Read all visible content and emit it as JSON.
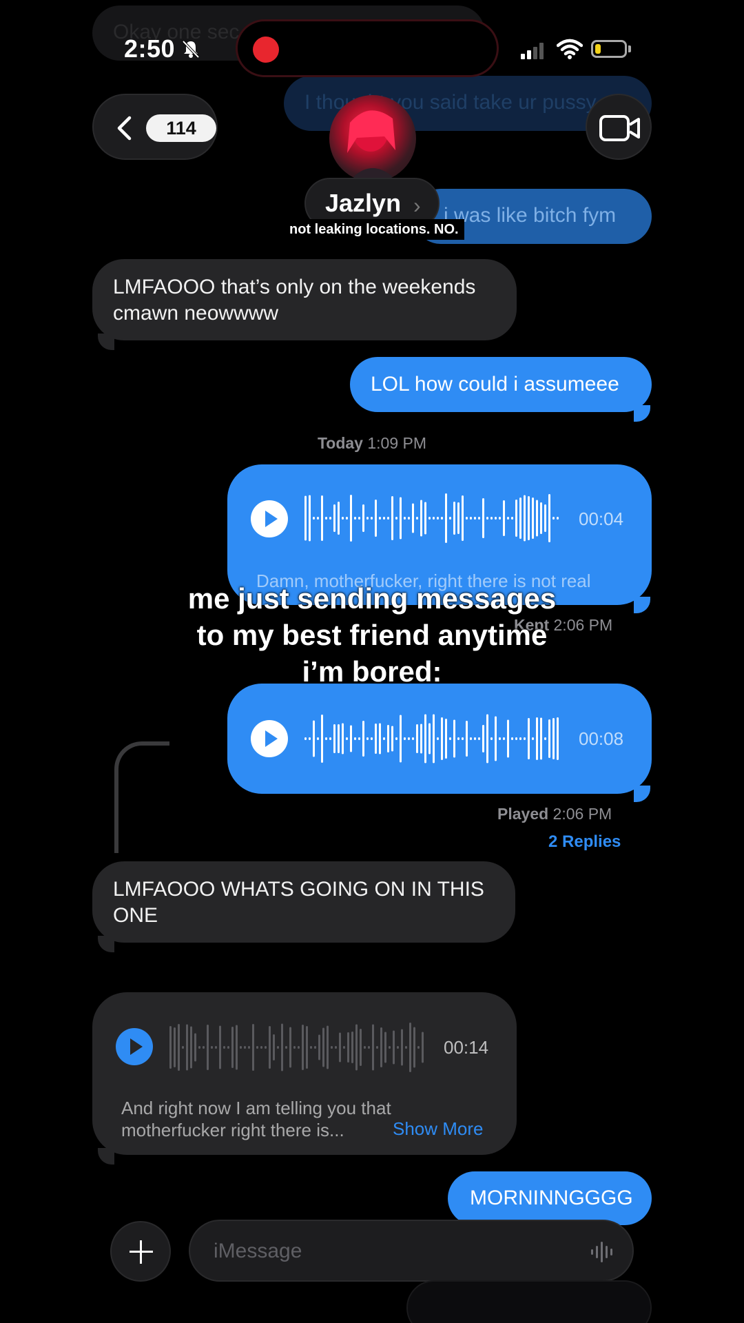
{
  "status_bar": {
    "time": "2:50"
  },
  "nav": {
    "unread_count": "114",
    "contact_name": "Jazlyn",
    "name_chevron": "›"
  },
  "caption_top": "not leaking locations. NO.",
  "background_messages": [
    {
      "text": "Okay one sec"
    },
    {
      "text": "I thought you said take ur pussy"
    },
    {
      "text": "i was like bitch fym"
    }
  ],
  "messages": [
    {
      "text": "LMFAOOO that’s only on the weekends cmawn neowwww"
    },
    {
      "text": "LOL how could i assumeee"
    },
    {
      "text": "LMFAOOO WHATS GOING ON IN THIS ONE"
    },
    {
      "text": "MORNINNGGGG"
    }
  ],
  "timestamps": {
    "today_label": "Today",
    "today_time": "1:09 PM",
    "kept_label": "Kept",
    "kept_time": "2:06 PM",
    "played_label": "Played",
    "played_time": "2:06 PM"
  },
  "replies_link": "2 Replies",
  "voice_messages": [
    {
      "duration": "00:04",
      "transcript": "Damn, motherfucker, right there is not real"
    },
    {
      "duration": "00:08"
    },
    {
      "duration": "00:14",
      "transcript_line1": "And right now I am telling you that",
      "transcript_line2": "motherfucker right there is...",
      "show_more": "Show More"
    }
  ],
  "overlay_text": {
    "line1": "me just sending messages",
    "line2": "to my best friend anytime",
    "line3": "i’m bored:"
  },
  "compose": {
    "placeholder": "iMessage"
  },
  "icons": [
    "bell-slash-icon",
    "recording-dot-icon",
    "signal-icon",
    "wifi-icon",
    "battery-icon",
    "chevron-left-icon",
    "video-camera-icon",
    "play-icon",
    "waveform-icon",
    "plus-icon",
    "microphone-waveform-icon"
  ],
  "colors": {
    "outgoing": "#2f8cf4",
    "incoming": "#262628",
    "background": "#000000",
    "recording": "#e8262e",
    "battery": "#f2d21a"
  }
}
